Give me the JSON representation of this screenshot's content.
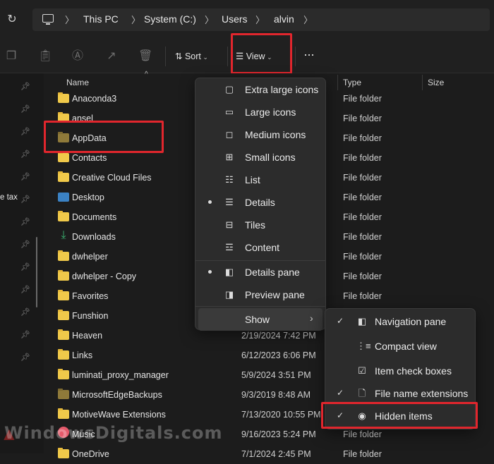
{
  "address": {
    "crumbs": [
      "This PC",
      "System (C:)",
      "Users",
      "alvin"
    ]
  },
  "toolbar": {
    "sort_label": "Sort",
    "view_label": "View",
    "more_label": "···"
  },
  "nav": {
    "partial_text": "e tax"
  },
  "columns": {
    "name": "Name",
    "type": "Type",
    "size": "Size"
  },
  "files": [
    {
      "name": "Anaconda3",
      "date": "",
      "type": "File folder"
    },
    {
      "name": "ansel",
      "date": "",
      "type": "File folder"
    },
    {
      "name": "AppData",
      "date": "",
      "type": "File folder"
    },
    {
      "name": "Contacts",
      "date": "",
      "type": "File folder"
    },
    {
      "name": "Creative Cloud Files",
      "date": "",
      "type": "File folder"
    },
    {
      "name": "Desktop",
      "date": "",
      "type": "File folder"
    },
    {
      "name": "Documents",
      "date": "",
      "type": "File folder"
    },
    {
      "name": "Downloads",
      "date": "",
      "type": "File folder"
    },
    {
      "name": "dwhelper",
      "date": "",
      "type": "File folder"
    },
    {
      "name": "dwhelper - Copy",
      "date": "",
      "type": "File folder"
    },
    {
      "name": "Favorites",
      "date": "",
      "type": "File folder"
    },
    {
      "name": "Funshion",
      "date": "",
      "type": "File folder"
    },
    {
      "name": "Heaven",
      "date": "2/19/2024 7:42 PM",
      "type": ""
    },
    {
      "name": "Links",
      "date": "6/12/2023 6:06 PM",
      "type": ""
    },
    {
      "name": "luminati_proxy_manager",
      "date": "5/9/2024 3:51 PM",
      "type": ""
    },
    {
      "name": "MicrosoftEdgeBackups",
      "date": "9/3/2019 8:48 AM",
      "type": ""
    },
    {
      "name": "MotiveWave Extensions",
      "date": "7/13/2020 10:55 PM",
      "type": ""
    },
    {
      "name": "Music",
      "date": "9/16/2023 5:24 PM",
      "type": "File folder"
    },
    {
      "name": "OneDrive",
      "date": "7/1/2024 2:45 PM",
      "type": "File folder"
    }
  ],
  "view_menu": {
    "items": [
      {
        "label": "Extra large icons",
        "icon": "extra-large-icons-icon"
      },
      {
        "label": "Large icons",
        "icon": "large-icons-icon"
      },
      {
        "label": "Medium icons",
        "icon": "medium-icons-icon"
      },
      {
        "label": "Small icons",
        "icon": "small-icons-icon"
      },
      {
        "label": "List",
        "icon": "list-icon"
      },
      {
        "label": "Details",
        "icon": "details-icon",
        "selected": true
      },
      {
        "label": "Tiles",
        "icon": "tiles-icon"
      },
      {
        "label": "Content",
        "icon": "content-icon"
      }
    ],
    "pane_items": [
      {
        "label": "Details pane",
        "icon": "details-pane-icon",
        "selected": true
      },
      {
        "label": "Preview pane",
        "icon": "preview-pane-icon"
      }
    ],
    "show_label": "Show"
  },
  "show_menu": {
    "items": [
      {
        "label": "Navigation pane",
        "checked": true
      },
      {
        "label": "Compact view",
        "checked": false
      },
      {
        "label": "Item check boxes",
        "checked": false
      },
      {
        "label": "File name extensions",
        "checked": true
      },
      {
        "label": "Hidden items",
        "checked": true
      }
    ]
  },
  "watermark": "WindowsDigitals.com",
  "colors": {
    "highlight_box": "#e1262d",
    "folder": "#f0c94a",
    "background": "#1c1c1c"
  }
}
